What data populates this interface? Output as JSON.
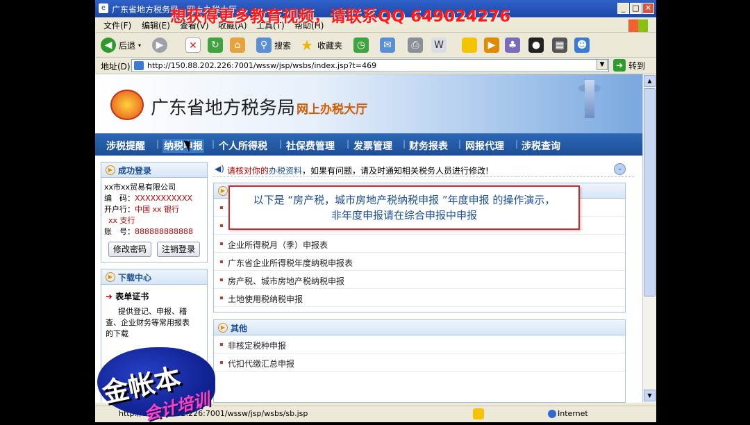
{
  "window": {
    "title": "广东省地方税务局 - 网上办税大厅",
    "min_label": "_",
    "max_label": "□",
    "close_label": "✕"
  },
  "watermark": "想获得更多教育视频，请联系QQ  649024276",
  "menu": [
    "文件(F)",
    "编辑(E)",
    "查看(V)",
    "收藏(A)",
    "工具(T)",
    "帮助(H)"
  ],
  "toolbar": {
    "back_label": "后退",
    "search_label": "搜索",
    "favorites_label": "收藏夹"
  },
  "address": {
    "label": "地址(D)",
    "url": "http://150.88.202.226:7001/wssw/jsp/wsbs/index.jsp?t=469",
    "go_label": "转到"
  },
  "banner": {
    "title": "广东省地方税务局",
    "subtitle": "网上办税大厅"
  },
  "nav": [
    "涉税提醒",
    "纳税申报",
    "个人所得税",
    "社保费管理",
    "发票管理",
    "财务报表",
    "网报代理",
    "涉税查询"
  ],
  "login_box": {
    "title": "成功登录",
    "company": "xx市xx贸易有限公司",
    "code_label": "编　码：",
    "code_value": "XXXXXXXXXXX",
    "bank_label": "开户行：",
    "bank_value": "中国 xx 银行",
    "bank_branch": "xx 支行",
    "account_label": "账　号：",
    "account_value": "888888888888",
    "change_pwd": "修改密码",
    "logout": "注销登录"
  },
  "download_box": {
    "title": "下载中心",
    "item_title": "表单证书",
    "item_desc_1": "提供登记、申报、稽",
    "item_desc_2": "查、企业财务等常用报表",
    "item_desc_3": "的下载"
  },
  "notice": {
    "red": "请核对你的",
    "blue": "办税资料",
    "rest": "，如果有问题，请及时通知相关税务人员进行修改!"
  },
  "declare_box": {
    "items": [
      "企业所得税月（季）申报表",
      "广东省企业所得税年度纳税申报表",
      "房产税、城市房地产税纳税申报",
      "土地使用税纳税申报"
    ]
  },
  "other_box": {
    "title": "其他",
    "items": [
      "非核定税种申报",
      "代扣代缴汇总申报"
    ]
  },
  "popup": {
    "line1": "以下是  “房产税，城市房地产税纳税申报 ”年度申报 的操作演示，",
    "line2": "非年度申报请在综合申报中申报"
  },
  "status": {
    "text": "http://150.88.202.226:7001/wssw/jsp/wsbs/sb.jsp",
    "zone": "Internet"
  },
  "logo": {
    "main": "金帐本",
    "sub": "会计培训"
  }
}
